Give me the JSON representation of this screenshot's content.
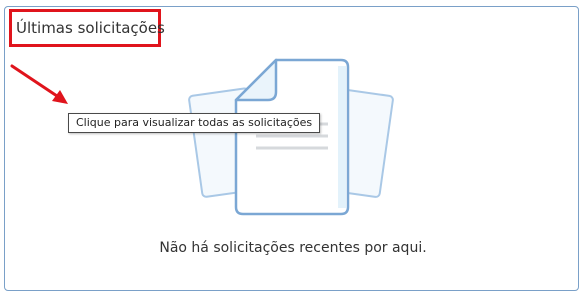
{
  "panel": {
    "title": "Últimas solicitações",
    "title_tooltip": "Clique para visualizar todas as solicitações",
    "empty_state_message": "Não há solicitações recentes por aqui.",
    "empty_state_icon": "documents-icon"
  },
  "annotations": {
    "highlight_color": "#e0141c",
    "arrow_icon": "red-arrow-icon"
  },
  "colors": {
    "card_border": "#7aa0c8",
    "illustration_stroke": "#7ba7d4",
    "illustration_fill": "#e8f4fb",
    "text": "#333333"
  }
}
